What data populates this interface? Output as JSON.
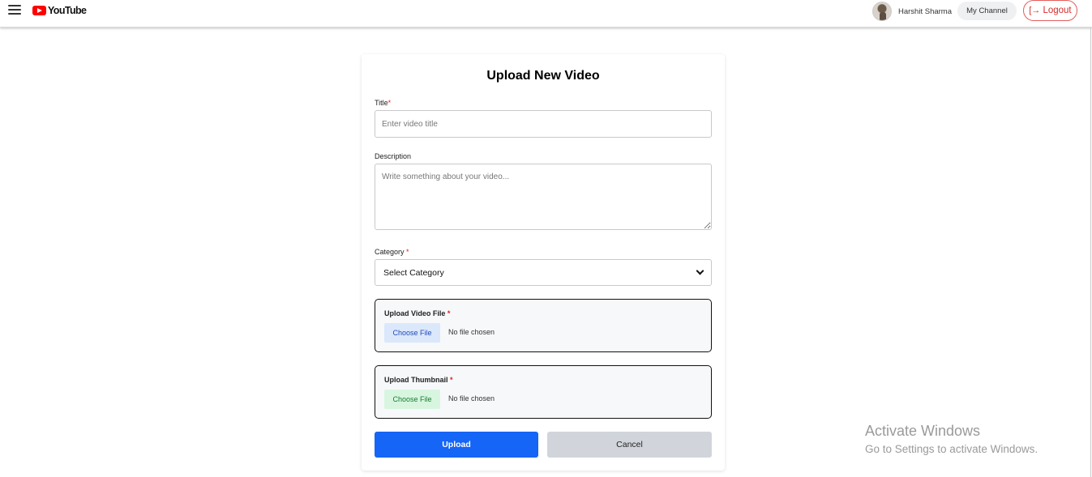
{
  "header": {
    "logo_text": "YouTube",
    "user_name": "Harshit Sharma",
    "my_channel_label": "My Channel",
    "logout_label": "Logout"
  },
  "form": {
    "title": "Upload New Video",
    "title_label": "Title",
    "title_placeholder": "Enter video title",
    "description_label": "Description",
    "description_placeholder": "Write something about your video...",
    "category_label": "Category",
    "category_value": "Select Category",
    "video_file_label": "Upload Video File",
    "thumbnail_label": "Upload Thumbnail",
    "choose_file_label": "Choose File",
    "no_file_text": "No file chosen",
    "required_mark": "*",
    "upload_label": "Upload",
    "cancel_label": "Cancel"
  },
  "watermark": {
    "title": "Activate Windows",
    "subtitle": "Go to Settings to activate Windows."
  },
  "colors": {
    "upload_button": "#1565f6",
    "cancel_button": "#d1d5db",
    "logout_accent": "#d72a2a",
    "brand_red": "#ff0000"
  },
  "icons": {
    "menu": "hamburger-menu-icon",
    "logo": "youtube-play-icon",
    "logout": "sign-out-icon",
    "select": "chevron-down-icon"
  }
}
